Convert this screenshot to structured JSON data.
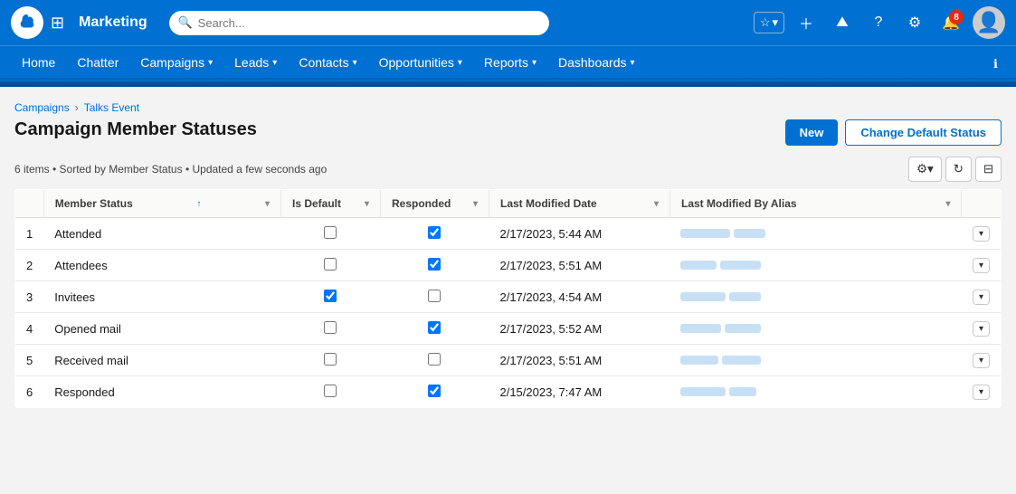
{
  "app": {
    "name": "Marketing",
    "logo_alt": "Salesforce"
  },
  "search": {
    "placeholder": "Search..."
  },
  "nav": {
    "items": [
      {
        "label": "Home",
        "has_caret": false
      },
      {
        "label": "Chatter",
        "has_caret": false
      },
      {
        "label": "Campaigns",
        "has_caret": true
      },
      {
        "label": "Leads",
        "has_caret": true
      },
      {
        "label": "Contacts",
        "has_caret": true
      },
      {
        "label": "Opportunities",
        "has_caret": true
      },
      {
        "label": "Reports",
        "has_caret": true
      },
      {
        "label": "Dashboards",
        "has_caret": true
      }
    ]
  },
  "notifications": {
    "count": "8"
  },
  "breadcrumb": {
    "parent": "Campaigns",
    "child": "Talks Event"
  },
  "page": {
    "title": "Campaign Member Statuses",
    "info": "6 items • Sorted by Member Status • Updated a few seconds ago"
  },
  "buttons": {
    "new": "New",
    "change_default": "Change Default Status"
  },
  "table": {
    "columns": [
      {
        "label": "Member Status",
        "sort": "↑",
        "has_caret": true
      },
      {
        "label": "Is Default",
        "has_caret": true
      },
      {
        "label": "Responded",
        "has_caret": true
      },
      {
        "label": "Last Modified Date",
        "has_caret": true
      },
      {
        "label": "Last Modified By Alias",
        "has_caret": true
      }
    ],
    "rows": [
      {
        "num": "1",
        "member_status": "Attended",
        "is_default": false,
        "responded": true,
        "last_modified": "2/17/2023, 5:44 AM",
        "alias_widths": [
          55,
          35
        ]
      },
      {
        "num": "2",
        "member_status": "Attendees",
        "is_default": false,
        "responded": true,
        "last_modified": "2/17/2023, 5:51 AM",
        "alias_widths": [
          40,
          45
        ]
      },
      {
        "num": "3",
        "member_status": "Invitees",
        "is_default": true,
        "responded": false,
        "last_modified": "2/17/2023, 4:54 AM",
        "alias_widths": [
          50,
          35
        ]
      },
      {
        "num": "4",
        "member_status": "Opened mail",
        "is_default": false,
        "responded": true,
        "last_modified": "2/17/2023, 5:52 AM",
        "alias_widths": [
          45,
          40
        ]
      },
      {
        "num": "5",
        "member_status": "Received mail",
        "is_default": false,
        "responded": false,
        "last_modified": "2/17/2023, 5:51 AM",
        "alias_widths": [
          42,
          43
        ]
      },
      {
        "num": "6",
        "member_status": "Responded",
        "is_default": false,
        "responded": true,
        "last_modified": "2/15/2023, 7:47 AM",
        "alias_widths": [
          50,
          30
        ]
      }
    ]
  }
}
